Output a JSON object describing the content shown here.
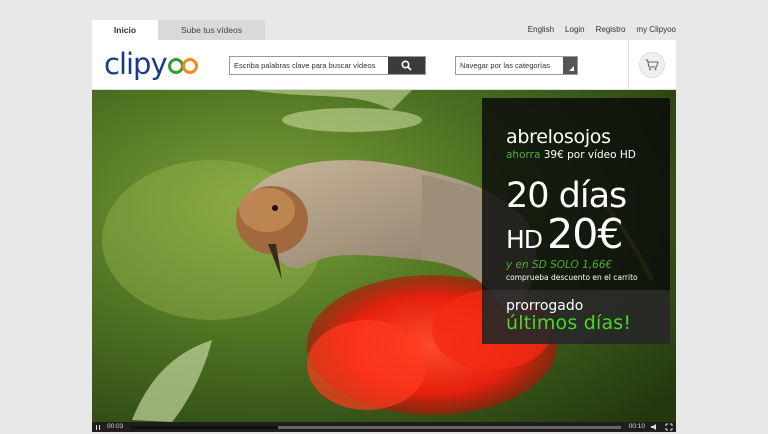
{
  "tabs": [
    {
      "label": "Inicio",
      "active": true
    },
    {
      "label": "Sube tus vídeos",
      "active": false
    }
  ],
  "top_links": [
    "English",
    "Login",
    "Registro",
    "my Clipyoo"
  ],
  "logo": {
    "text": "clipy"
  },
  "search": {
    "placeholder": "Escriba palabras clave para buscar vídeos",
    "icon": "search-icon"
  },
  "nav_select": {
    "value": "Navegar por las categorías"
  },
  "cart": {
    "icon": "cart-icon"
  },
  "promo": {
    "headline": "abrelosojos",
    "sub_green": "ahorra",
    "sub_white": "39€ por vídeo HD",
    "big_line1": "20 días",
    "hd_small": "HD",
    "hd_big": "20€",
    "sd_line": "y en SD SOLO 1,66€",
    "note": "comprueba descuento en el carrito",
    "extended": "prorrogado",
    "last_days": "últimos días!"
  },
  "player": {
    "current_time": "00:03",
    "duration": "00:10",
    "progress": 0.3,
    "buffered": 0.3
  },
  "colors": {
    "logo_blue": "#1a3a8a",
    "logo_green": "#3a9a3a",
    "logo_orange": "#f08a1a",
    "promo_green": "#4caf2a"
  }
}
